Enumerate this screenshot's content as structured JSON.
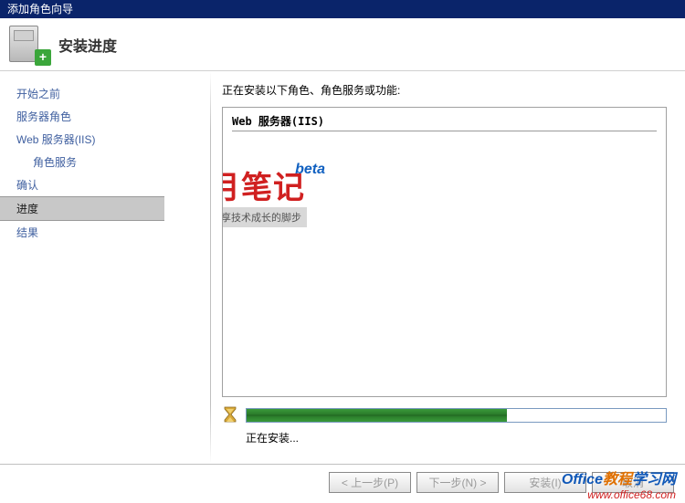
{
  "window": {
    "title": "添加角色向导"
  },
  "header": {
    "title": "安装进度"
  },
  "sidebar": {
    "items": [
      {
        "label": "开始之前",
        "active": false,
        "indent": false
      },
      {
        "label": "服务器角色",
        "active": false,
        "indent": false
      },
      {
        "label": "Web 服务器(IIS)",
        "active": false,
        "indent": false
      },
      {
        "label": "角色服务",
        "active": false,
        "indent": true
      },
      {
        "label": "确认",
        "active": false,
        "indent": false
      },
      {
        "label": "进度",
        "active": true,
        "indent": false
      },
      {
        "label": "结果",
        "active": false,
        "indent": false
      }
    ]
  },
  "main": {
    "instruction": "正在安装以下角色、角色服务或功能:",
    "role_heading": "Web 服务器(IIS)",
    "status": "正在安装..."
  },
  "progress": {
    "percent": 62
  },
  "buttons": {
    "prev": "< 上一步(P)",
    "next": "下一步(N) >",
    "install": "安装(I)",
    "cancel": "取消"
  },
  "watermark_center": {
    "beta": "beta",
    "main": "晓月笔记",
    "sub": "记录和分享技术成长的脚步"
  },
  "watermark_footer": {
    "line1_pre": "Office",
    "line1_hl": "教程",
    "line1_post": "学习网",
    "line2": "www.office68.com"
  }
}
